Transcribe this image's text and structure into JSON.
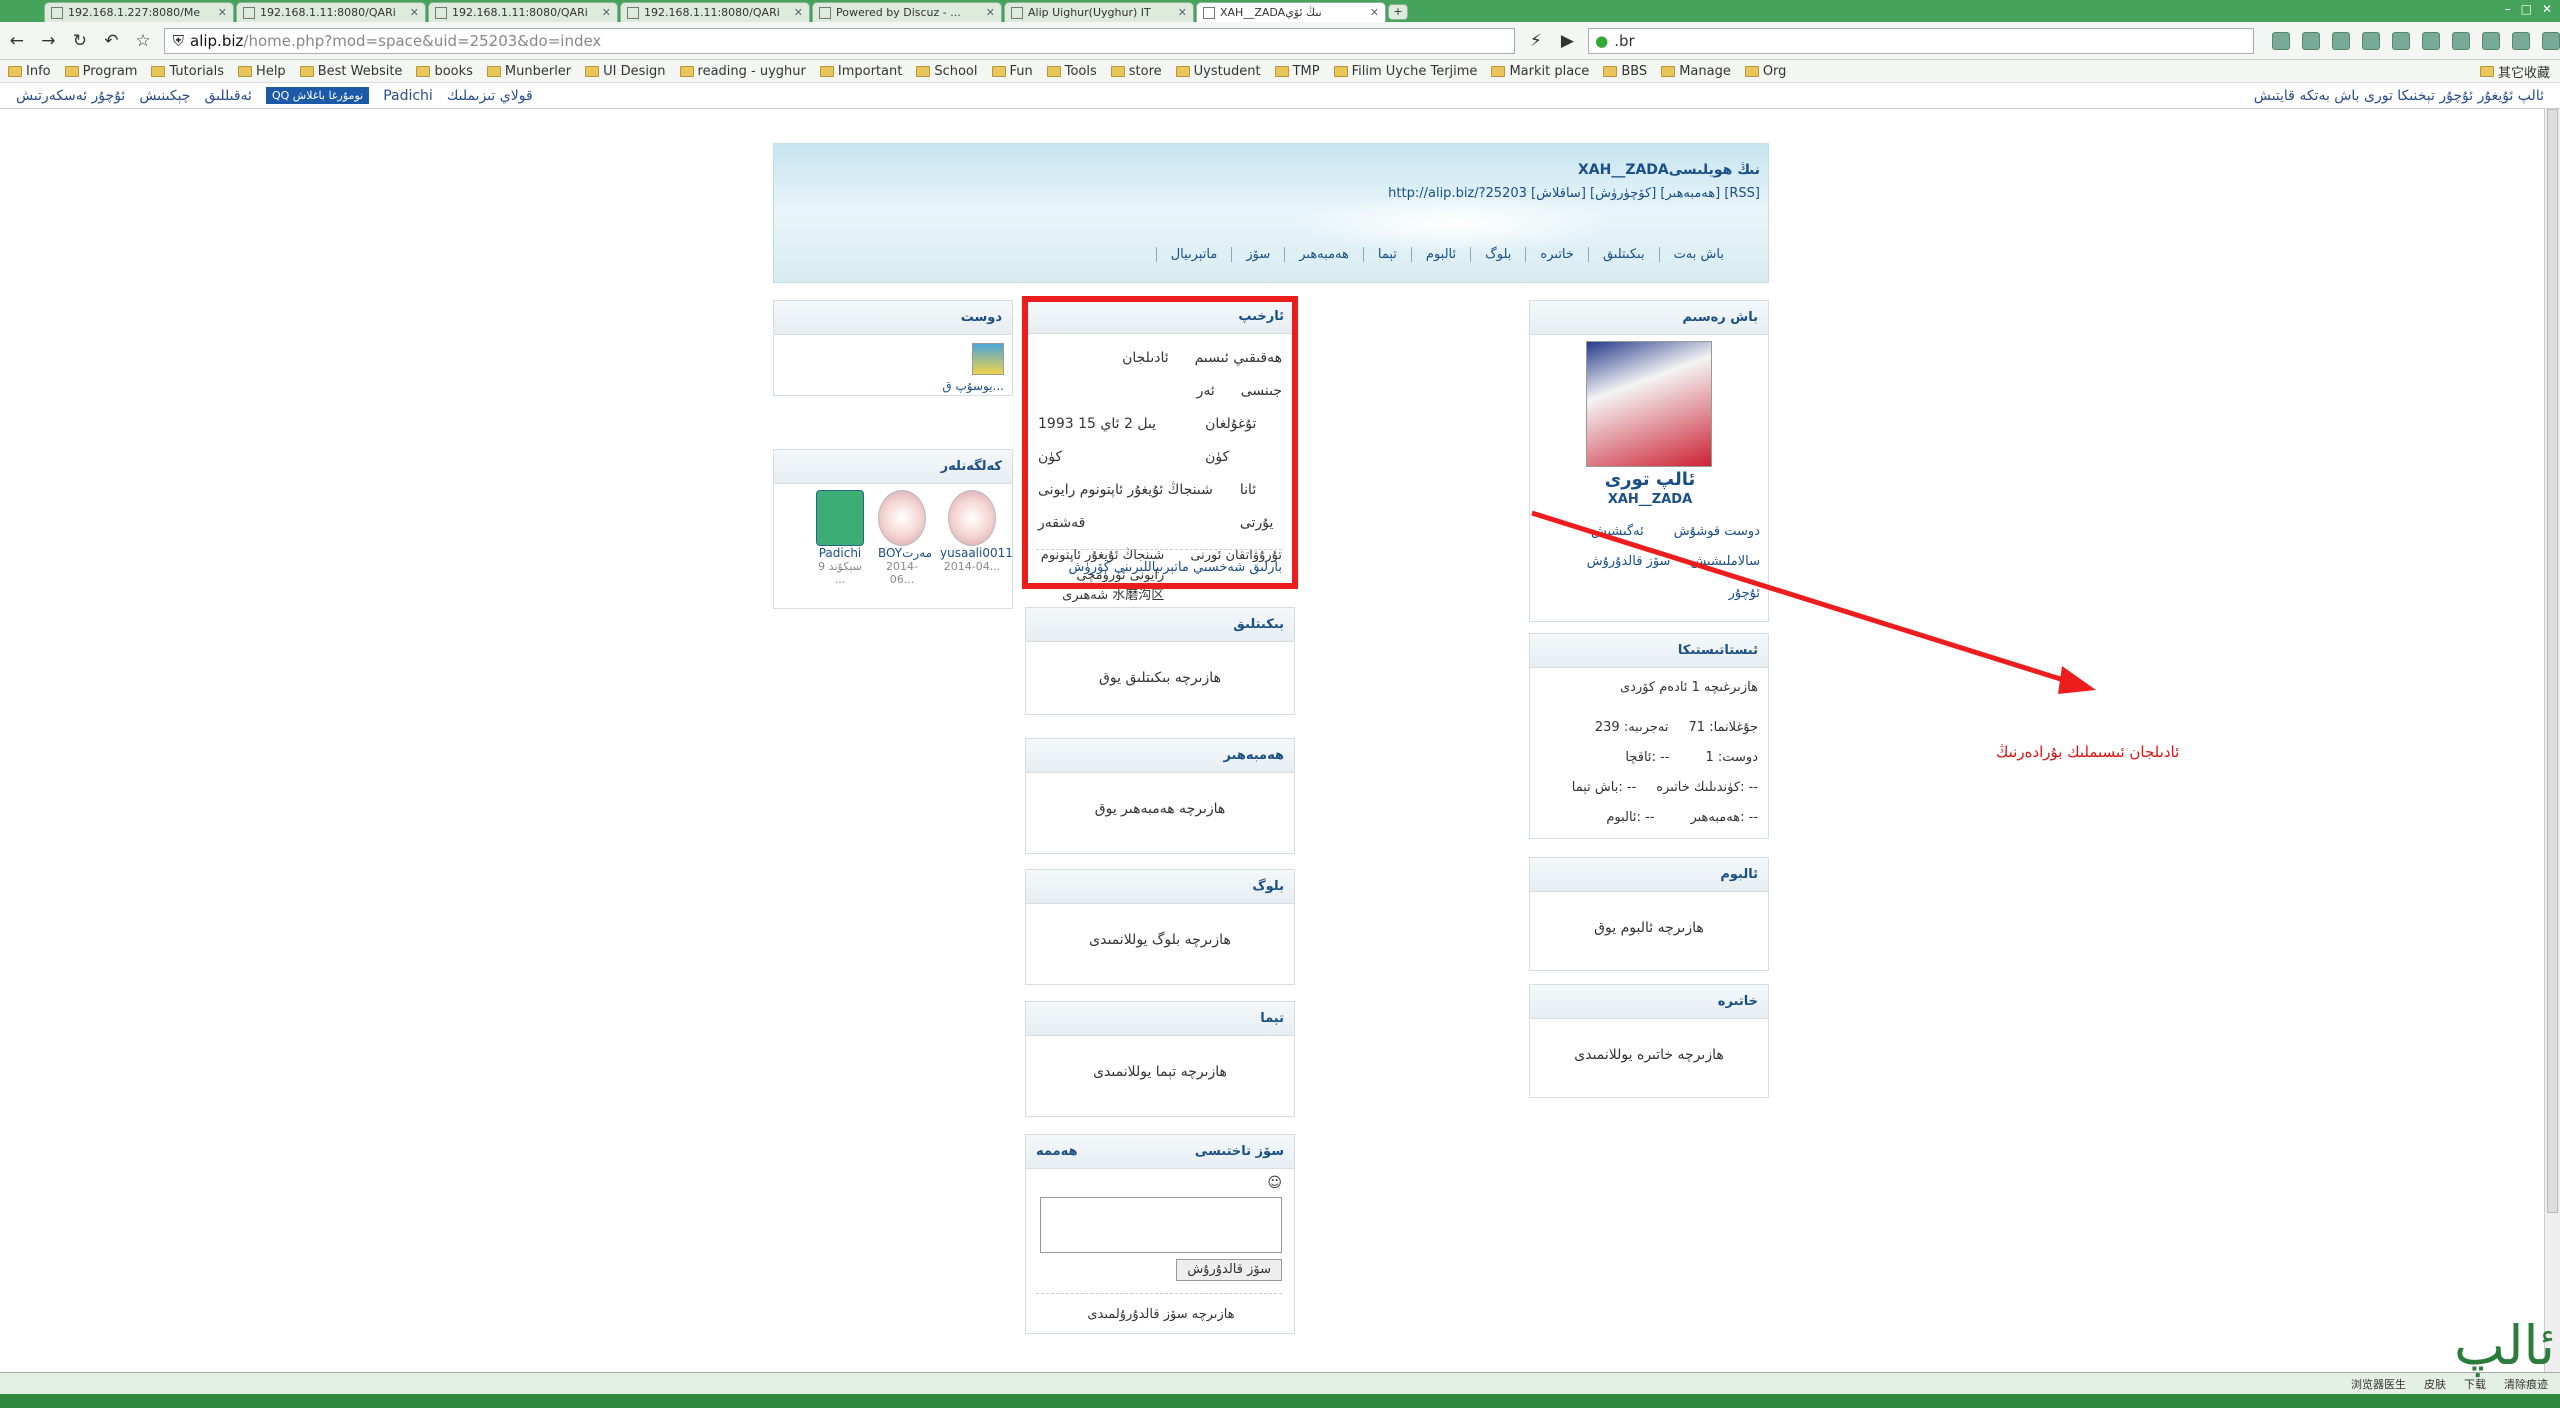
{
  "tabs": [
    {
      "label": "192.168.1.227:8080/Me"
    },
    {
      "label": "192.168.1.11:8080/QARi"
    },
    {
      "label": "192.168.1.11:8080/QARi"
    },
    {
      "label": "192.168.1.11:8080/QARi"
    },
    {
      "label": "Powered by Discuz - ..."
    },
    {
      "label": "Alip Uighur(Uyghur) IT"
    },
    {
      "label": "XAH__ZADAنىڭ ئۆي"
    }
  ],
  "address": {
    "host": "alip.biz",
    "path": "/home.php?mod=space&uid=25203&do=index"
  },
  "search_value": ".br",
  "bookmarks": [
    "Info",
    "Program",
    "Tutorials",
    "Help",
    "Best Website",
    "books",
    "Munberler",
    "UI Design",
    "reading - uyghur",
    "Important",
    "School",
    "Fun",
    "Tools",
    "store",
    "Uystudent",
    "TMP",
    "Filim Uyche Terjime",
    "Markit place",
    "BBS",
    "Manage",
    "Org"
  ],
  "bookmarks_right": "其它收藏",
  "sitebar": {
    "left_links": [
      "ئۇچۇر ئەسكەرتىش",
      "چېكىنىش",
      "ئەقىللىق"
    ],
    "qq": "QQ نومۇرغا باغلاش",
    "user": "Padichi",
    "prompt": "قولاي تىزىملىك",
    "right": "ئالپ ئۇيغۇر ئۇچۇر تېخنىكا تورى  باش بەتكە قايتىش"
  },
  "header": {
    "title": "XAH__ZADAنىڭ ھويلىسى",
    "links": "http://alip.biz/?25203 [ساقلاش] [كۆچۈرۈش] [ھەمبەھىر] [RSS]",
    "nav": [
      "باش بەت",
      "بىكىتلىق",
      "خاتىرە",
      "بلوگ",
      "ئالبوم",
      "تېما",
      "ھەمبەھىر",
      "سۆز",
      "ماتېرىيال"
    ]
  },
  "profile": {
    "title": "باش رەسىم",
    "name": "ئالپ تورى",
    "username": "XAH__ZADA",
    "actions": [
      "ئەگىشىش",
      "دوست قوشۇش",
      "سۆز قالدۇرۇش",
      "سالاملىشىش",
      "ئۇچۇر"
    ]
  },
  "stats": {
    "title": "ئىستاتىستىكا",
    "visits": "ھازىرغىچە 1 ئادەم كۆردى",
    "exp": "تەجرىبە: 239",
    "points": "جۇغلانما: 71",
    "tax": "ئاقچا: --",
    "friends": "دوست: 1",
    "themes": "باش تېما: --",
    "diaries": "كۈندىلىك خاتىرە: --",
    "albums": "ئالبوم: --",
    "shares": "ھەمبەھىر: --"
  },
  "album_box": {
    "title": "ئالبوم",
    "text": "ھازىرچە ئالبوم يوق"
  },
  "diary_box": {
    "title": "خاتىرە",
    "text": "ھازىرچە خاتىرە يوللانمىدى"
  },
  "profile_info": {
    "title": "ئارخىپ",
    "rows": [
      {
        "k": "ئادىلجان",
        "v": "ھەقىقىي ئىسىم"
      },
      {
        "k": "جىنسى",
        "v": "ئەر"
      },
      {
        "k": "تۇغۇلغان كۈن",
        "v": "1993 يىل 2 ئاي 15 كۈن"
      },
      {
        "k": "ئانا يۇرتى",
        "v": "شىنجاڭ ئۇيغۇر ئاپتونوم رايونى قەشقەر"
      },
      {
        "k": "تۇرۇۋاتقان ئورنى",
        "v": "شىنجاڭ ئۇيغۇر ئاپتونوم رايونى ئۈرۈمچى شەھىرى 水磨沟区"
      }
    ],
    "more": "بارلىق شەخسىي ماتېرىياللىرىنى كۆرۈش"
  },
  "sections": [
    {
      "title": "بىكىتلىق",
      "text": "ھازىرچە بىكىتلىق يوق"
    },
    {
      "title": "ھەمبەھىر",
      "text": "ھازىرچە ھەمبەھىر يوق"
    },
    {
      "title": "بلوگ",
      "text": "ھازىرچە بلوگ يوللانمىدى"
    },
    {
      "title": "تېما",
      "text": "ھازىرچە تېما يوللانمىدى"
    }
  ],
  "comment": {
    "title": "سۆز تاختىسى",
    "all": "ھەممە",
    "button": "سۆز قالدۇرۇش",
    "empty": "ھازىرچە سۆز قالدۇرۇلمىدى"
  },
  "friends_box": {
    "title": "دوست",
    "name": "يوسۇپ ق..."
  },
  "visitors_box": {
    "title": "كەلگەنلەر",
    "items": [
      {
        "name": "Padichi",
        "date": "9 سېكۇند ..."
      },
      {
        "name": "BOYمەرت",
        "date": "2014-06..."
      },
      {
        "name": "yusaali0011",
        "date": "2014-04..."
      }
    ]
  },
  "annotation": "ئادىلجان ئىسىملىك بۇرادەرنىڭ",
  "statusbar": [
    "浏览器医生",
    "皮肤",
    "下载",
    "清除痕迹"
  ],
  "colors": {
    "accent": "#1a4e86",
    "highlight": "#ee1d1d",
    "chrome": "#45a35c"
  }
}
